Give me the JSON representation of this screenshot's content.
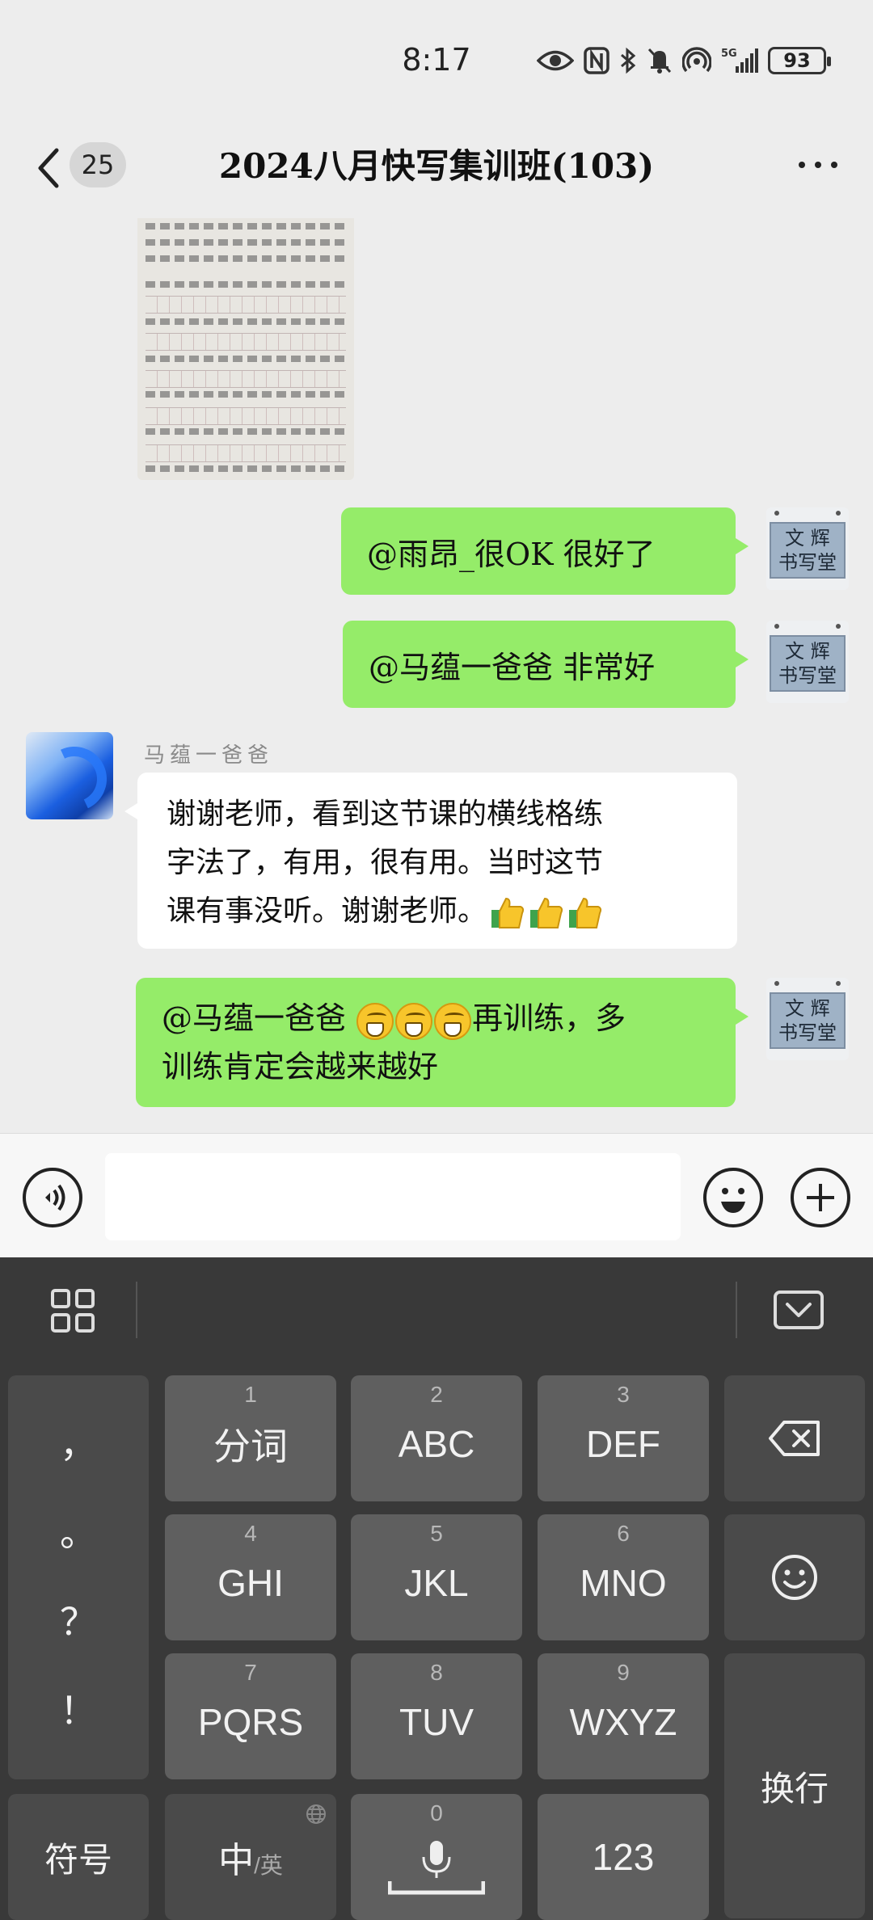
{
  "status": {
    "time": "8:17",
    "battery": "93",
    "network": "5G"
  },
  "nav": {
    "unread_count": "25",
    "title": "2024八月快写集训班(103)"
  },
  "avatar_right_text": [
    "文 辉",
    "书写堂"
  ],
  "messages": [
    {
      "type": "image",
      "side": "left",
      "icon": "handwriting-photo"
    },
    {
      "type": "text",
      "side": "right",
      "text": "@雨昂_很OK 很好了"
    },
    {
      "type": "text",
      "side": "right",
      "text": "@马蕴一爸爸 非常好"
    },
    {
      "type": "text",
      "side": "left",
      "sender": "马蕴一爸爸",
      "lines": [
        "谢谢老师，看到这节课的横线格练",
        "字法了，有用，很有用。当时这节",
        "课有事没听。谢谢老师。"
      ],
      "emoji_trailing": [
        "thumbs-up",
        "thumbs-up",
        "thumbs-up"
      ]
    },
    {
      "type": "text",
      "side": "right",
      "line1_prefix": "@马蕴一爸爸 ",
      "line1_suffix": "再训练，多",
      "line2": "训练肯定会越来越好",
      "emoji_inline": [
        "grin",
        "grin",
        "grin"
      ]
    }
  ],
  "input": {
    "placeholder": ""
  },
  "keyboard": {
    "punctuation": [
      "，",
      "。",
      "？",
      "！"
    ],
    "rows": [
      [
        {
          "num": "1",
          "label": "分词"
        },
        {
          "num": "2",
          "label": "ABC"
        },
        {
          "num": "3",
          "label": "DEF"
        }
      ],
      [
        {
          "num": "4",
          "label": "GHI"
        },
        {
          "num": "5",
          "label": "JKL"
        },
        {
          "num": "6",
          "label": "MNO"
        }
      ],
      [
        {
          "num": "7",
          "label": "PQRS"
        },
        {
          "num": "8",
          "label": "TUV"
        },
        {
          "num": "9",
          "label": "WXYZ"
        }
      ]
    ],
    "symbols_label": "符号",
    "lang_main": "中",
    "lang_alt": "/英",
    "space_num": "0",
    "numbers_label": "123",
    "enter_label": "换行"
  }
}
